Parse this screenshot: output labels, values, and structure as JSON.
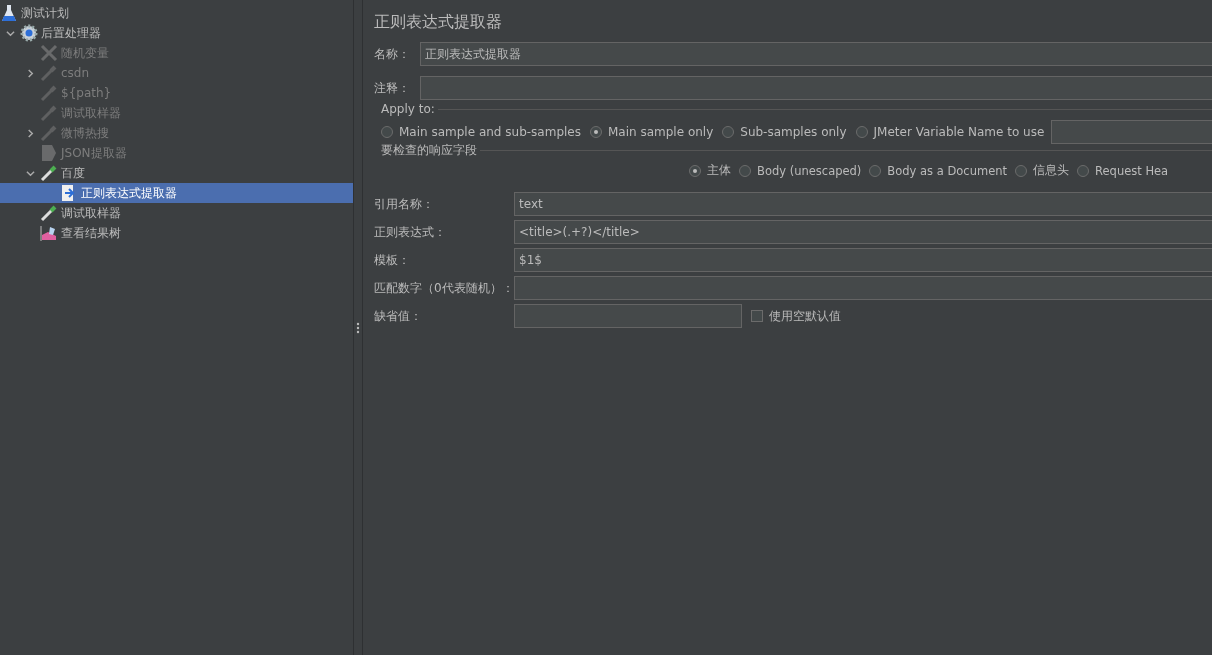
{
  "tree": [
    {
      "label": "测试计划",
      "kind": "plan",
      "disabled": false,
      "selected": false,
      "children": [
        {
          "label": "后置处理器",
          "kind": "config",
          "disabled": false,
          "selected": false,
          "expanded": true,
          "children": [
            {
              "label": "随机变量",
              "kind": "wrench",
              "disabled": true,
              "selected": false
            },
            {
              "label": "csdn",
              "kind": "pipette",
              "disabled": true,
              "selected": false,
              "expanded": false
            },
            {
              "label": "${path}",
              "kind": "pipette",
              "disabled": true,
              "selected": false
            },
            {
              "label": "调试取样器",
              "kind": "pipette",
              "disabled": true,
              "selected": false
            },
            {
              "label": "微博热搜",
              "kind": "pipette",
              "disabled": true,
              "selected": false,
              "expanded": false
            },
            {
              "label": "JSON提取器",
              "kind": "document",
              "disabled": true,
              "selected": false
            },
            {
              "label": "百度",
              "kind": "pipette",
              "disabled": false,
              "selected": false,
              "expanded": true,
              "children": [
                {
                  "label": "正则表达式提取器",
                  "kind": "regex",
                  "disabled": false,
                  "selected": true
                }
              ]
            },
            {
              "label": "调试取样器",
              "kind": "pipette",
              "disabled": false,
              "selected": false
            },
            {
              "label": "查看结果树",
              "kind": "chart",
              "disabled": false,
              "selected": false
            }
          ]
        }
      ]
    }
  ],
  "panel": {
    "title": "正则表达式提取器",
    "name": {
      "label": "名称：",
      "value": "正则表达式提取器"
    },
    "comment": {
      "label": "注释："
    },
    "apply_to": {
      "legend": "Apply to:",
      "options": [
        {
          "label": "Main sample and sub-samples",
          "selected": false
        },
        {
          "label": "Main sample only",
          "selected": true
        },
        {
          "label": "Sub-samples only",
          "selected": false
        },
        {
          "label": "JMeter Variable Name to use",
          "selected": false
        }
      ]
    },
    "response_field": {
      "legend": "要检查的响应字段",
      "options": [
        {
          "label": "主体",
          "selected": true
        },
        {
          "label": "Body (unescaped)",
          "selected": false
        },
        {
          "label": "Body as a Document",
          "selected": false
        },
        {
          "label": "信息头",
          "selected": false
        },
        {
          "label": "Request Hea",
          "selected": false
        }
      ]
    },
    "fields": [
      {
        "label": "引用名称：",
        "value": "text"
      },
      {
        "label": "正则表达式：",
        "value": "<title>(.+?)</title>"
      },
      {
        "label": "模板：",
        "value": "$1$"
      },
      {
        "label": "匹配数字（0代表随机）："
      }
    ],
    "default": {
      "label": "缺省值：",
      "checkbox": {
        "label": "使用空默认值",
        "checked": false
      }
    }
  }
}
